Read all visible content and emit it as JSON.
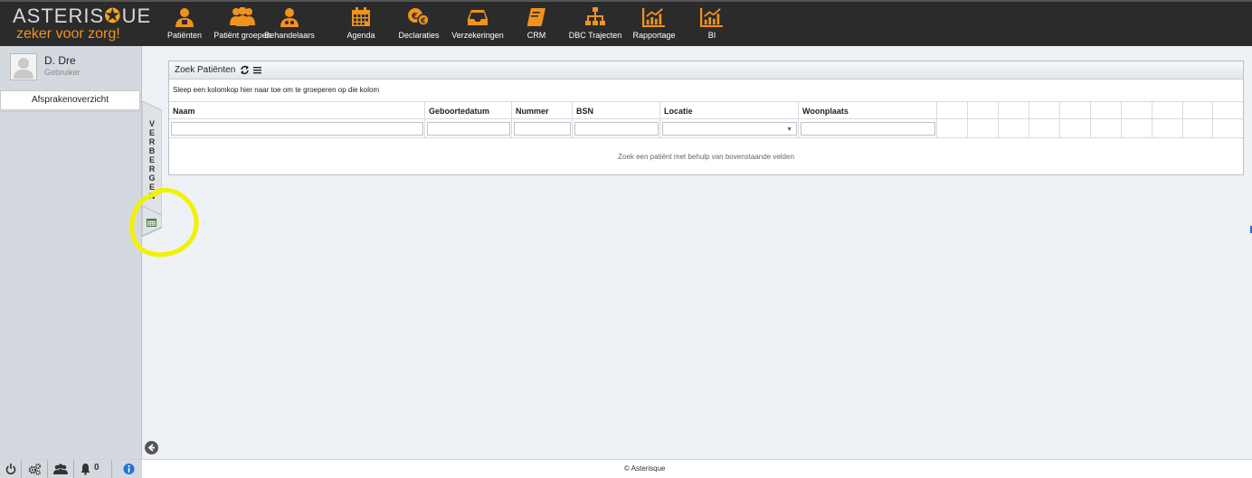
{
  "app": {
    "logo_text": "ASTERISQUE",
    "tagline": "zeker voor zorg!",
    "brand_color": "#f0921d",
    "topbar_color": "#2b2b2b"
  },
  "nav": [
    {
      "label": "Patiënten",
      "icon": "user-icon"
    },
    {
      "label": "Patiënt groepen",
      "icon": "users-icon"
    },
    {
      "label": "Behandelaars",
      "icon": "doctor-icon"
    },
    {
      "label": "Agenda",
      "icon": "calendar-icon"
    },
    {
      "label": "Declaraties",
      "icon": "euro-coins-icon"
    },
    {
      "label": "Verzekeringen",
      "icon": "inbox-icon"
    },
    {
      "label": "CRM",
      "icon": "book-icon"
    },
    {
      "label": "DBC Trajecten",
      "icon": "sitemap-icon"
    },
    {
      "label": "Rapportage",
      "icon": "chart-icon"
    },
    {
      "label": "BI",
      "icon": "chart-icon"
    }
  ],
  "sidebar": {
    "user_name": "D. Dre",
    "user_role": "Gebruiker",
    "menu_button": "Afsprakenoverzicht",
    "hide_tab_letters": [
      "V",
      "E",
      "R",
      "B",
      "E",
      "R",
      "G",
      "E",
      "N"
    ]
  },
  "panel": {
    "title": "Zoek Patiënten",
    "group_hint": "Sleep een kolomkop hier naar toe om te groeperen op die kolom",
    "columns": [
      "Naam",
      "Geboortedatum",
      "Nummer",
      "BSN",
      "Locatie",
      "Woonplaats"
    ],
    "empty_message": "Zoek een patiënt met behulp van bovenstaande velden"
  },
  "statusbar": {
    "notification_count": "0",
    "copyright": "© Asterisque"
  }
}
